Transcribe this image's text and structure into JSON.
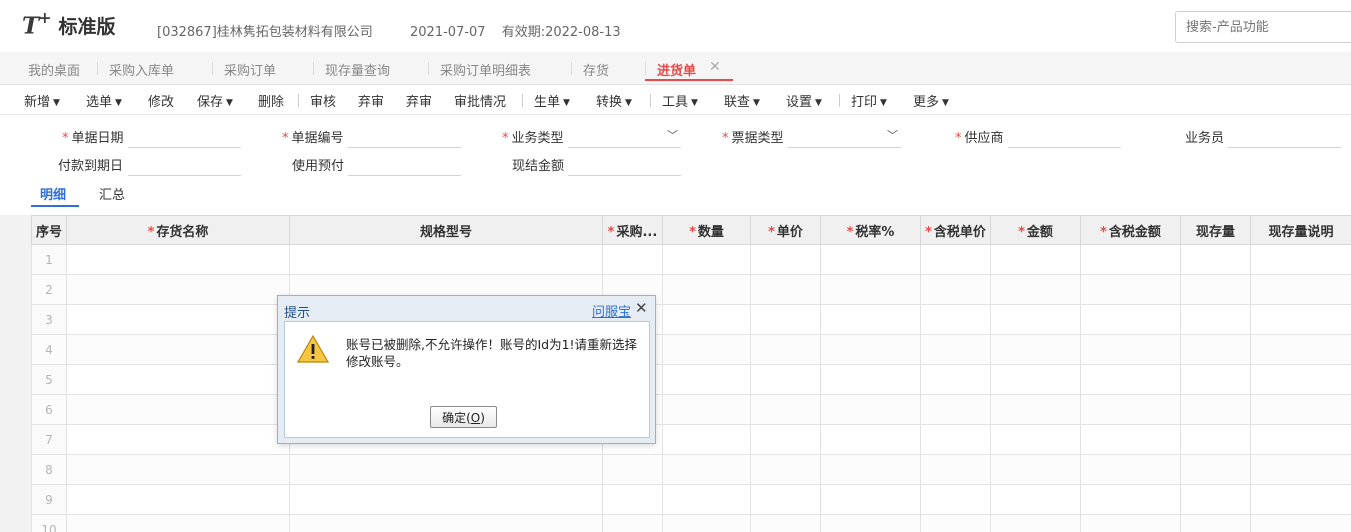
{
  "header": {
    "logo_mark": "T",
    "logo_plus": "+",
    "logo_text": "标准版",
    "company": "[032867]桂林隽拓包装材料有限公司",
    "date": "2021-07-07",
    "validity": "有效期:2022-08-13",
    "search_placeholder": "搜索-产品功能"
  },
  "tabs": [
    "我的桌面",
    "采购入库单",
    "采购订单",
    "现存量查询",
    "采购订单明细表",
    "存货",
    "进货单"
  ],
  "toolbar": {
    "items": [
      "新增",
      "选单",
      "修改",
      "保存",
      "删除",
      "审核",
      "弃审",
      "弃审",
      "审批情况",
      "生单",
      "转换",
      "工具",
      "联查",
      "设置",
      "打印",
      "更多"
    ]
  },
  "form": {
    "doc_date": "单据日期",
    "doc_no": "单据编号",
    "biz_type": "业务类型",
    "invoice_type": "票据类型",
    "supplier": "供应商",
    "salesman": "业务员",
    "due_date": "付款到期日",
    "prepay": "使用预付",
    "cash_amount": "现结金额"
  },
  "detail_tabs": [
    "明细",
    "汇总"
  ],
  "grid": {
    "columns": [
      "序号",
      "存货名称",
      "规格型号",
      "采购...",
      "数量",
      "单价",
      "税率%",
      "含税单价",
      "金额",
      "含税金额",
      "现存量",
      "现存量说明"
    ],
    "rows": [
      "1",
      "2",
      "3",
      "4",
      "5",
      "6",
      "7",
      "8",
      "9",
      "10"
    ]
  },
  "modal": {
    "title": "提示",
    "help": "问服宝",
    "close": "✕",
    "message": "账号已被删除,不允许操作！账号的Id为1!请重新选择修改账号。",
    "ok_label": "确定(",
    "ok_key": "O",
    "ok_suffix": ")"
  },
  "colors": {
    "accent_red": "#e84a4a",
    "accent_blue": "#2f6fd6"
  }
}
